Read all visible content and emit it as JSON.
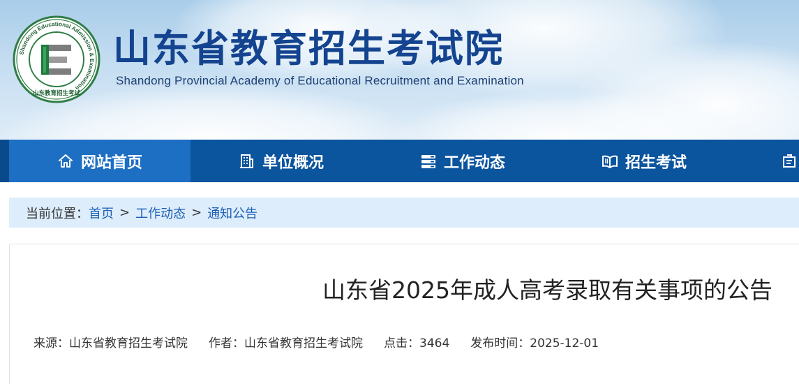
{
  "header": {
    "logo": {
      "ring_text": "Shandong Educational Admission & Examination",
      "bottom_text": "山东教育招生考试",
      "letter": "E"
    },
    "title_cn": "山东省教育招生考试院",
    "title_en": "Shandong Provincial Academy of Educational Recruitment and Examination"
  },
  "nav": {
    "items": [
      {
        "label": "网站首页",
        "icon": "home-icon"
      },
      {
        "label": "单位概况",
        "icon": "building-icon"
      },
      {
        "label": "工作动态",
        "icon": "server-icon"
      },
      {
        "label": "招生考试",
        "icon": "book-icon"
      }
    ]
  },
  "breadcrumb": {
    "prefix": "当前位置：",
    "items": [
      "首页",
      "工作动态",
      "通知公告"
    ],
    "separator": ">"
  },
  "article": {
    "title": "山东省2025年成人高考录取有关事项的公告",
    "meta": {
      "source_label": "来源：",
      "source": "山东省教育招生考试院",
      "author_label": "作者：",
      "author": "山东省教育招生考试院",
      "hits_label": "点击：",
      "hits": "3464",
      "date_label": "发布时间：",
      "date": "2025-12-01"
    }
  },
  "colors": {
    "title_blue": "#14448f",
    "nav_bg": "#0b549e",
    "nav_active": "#1d6fc4",
    "breadcrumb_bg": "#deedfc",
    "logo_green": "#2f7d45"
  }
}
